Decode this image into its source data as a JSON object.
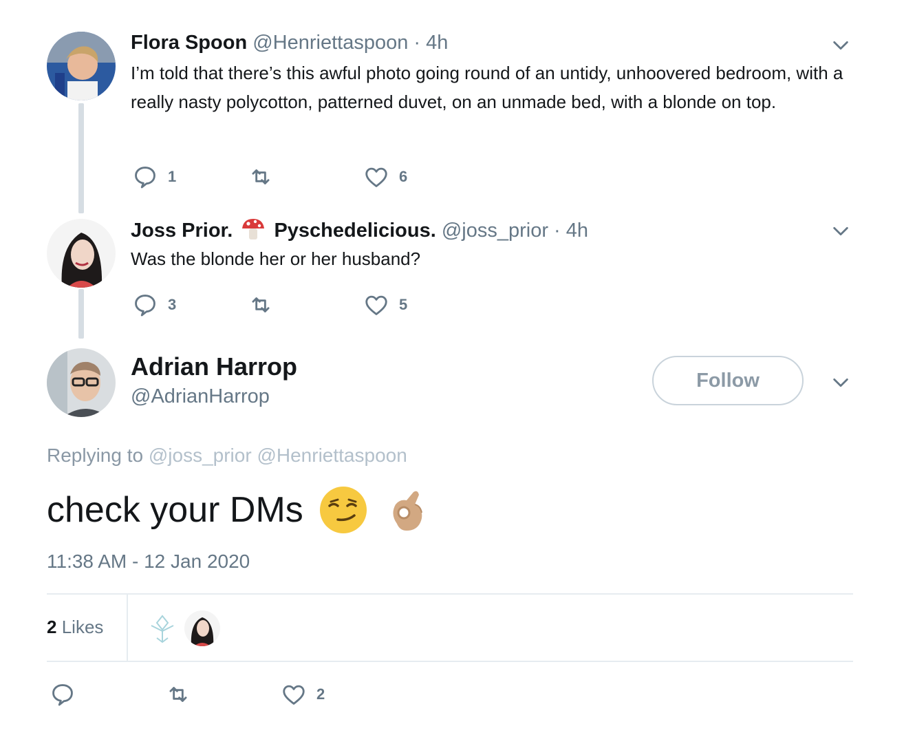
{
  "thread": [
    {
      "name": "Flora Spoon",
      "handle": "@Henriettaspoon",
      "separator": "·",
      "time": "4h",
      "text": "I’m told that there’s this awful photo going round of an untidy, unhoovered bedroom, with a really nasty polycotton, patterned duvet, on an unmade bed, with a blonde on top.",
      "reply_count": "1",
      "retweet_count": "",
      "like_count": "6"
    },
    {
      "name": "Joss Prior.",
      "name_emoji": "mushroom",
      "name_suffix": "Pyschedelicious.",
      "handle": "@joss_prior",
      "separator": "·",
      "time": "4h",
      "text": "Was the blonde her or her husband?",
      "reply_count": "3",
      "retweet_count": "",
      "like_count": "5"
    }
  ],
  "main_tweet": {
    "name": "Adrian Harrop",
    "handle": "@AdrianHarrop",
    "follow_label": "Follow",
    "replying_prefix": "Replying to",
    "replying_mentions": "@joss_prior @Henriettaspoon",
    "text": "check your DMs",
    "emojis": [
      "smirking-face",
      "ok-hand"
    ],
    "timestamp": "11:38 AM - 12 Jan 2020",
    "likes_count": "2",
    "likes_label": "Likes",
    "reply_count": "",
    "retweet_count": "",
    "like_count": "2"
  },
  "colors": {
    "text": "#14171a",
    "secondary": "#657786",
    "divider": "#e6ecf0",
    "thread_line": "#d6dde3"
  }
}
